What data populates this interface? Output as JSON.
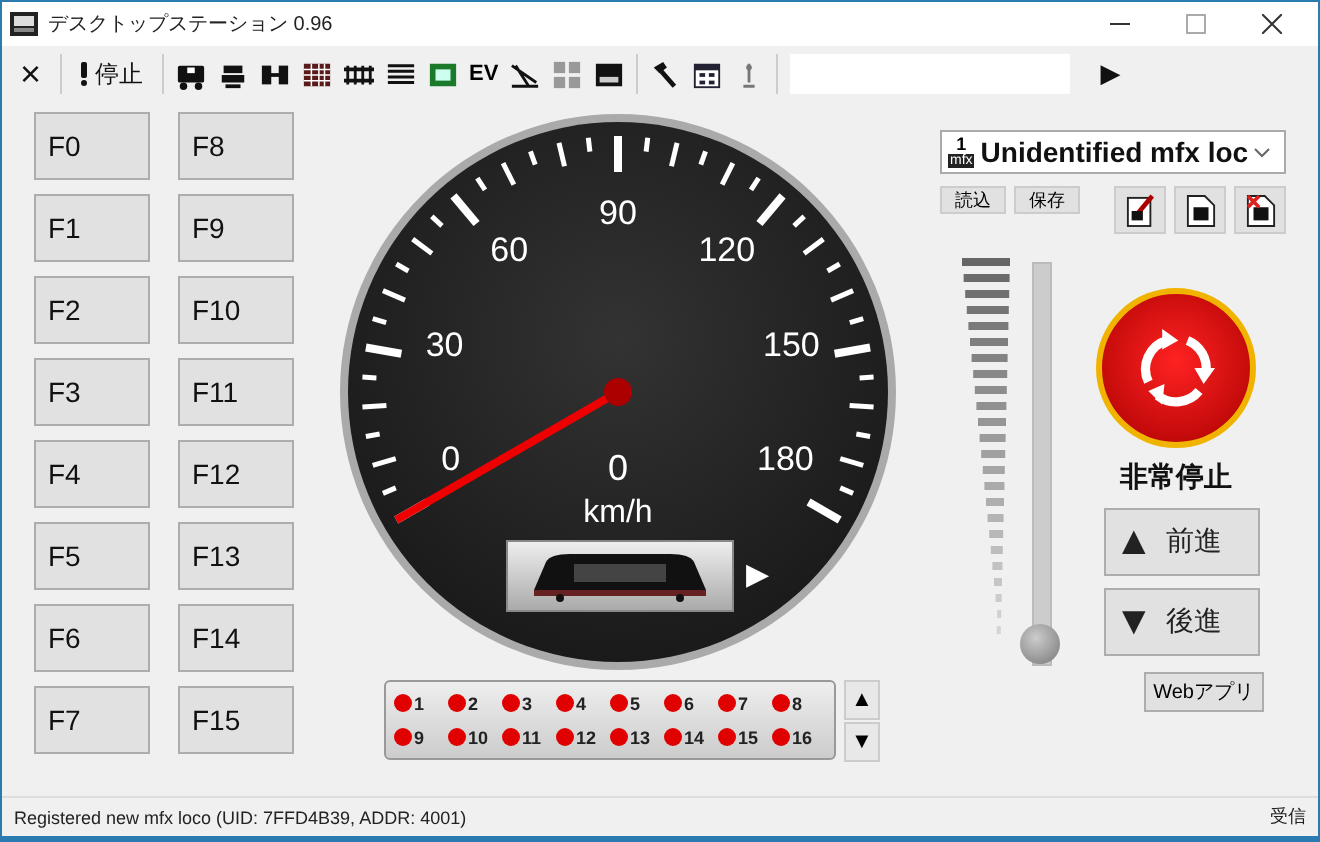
{
  "window": {
    "title": "デスクトップステーション 0.96"
  },
  "toolbar": {
    "close_glyph": "×",
    "stop_label": "停止",
    "ev_label": "EV",
    "run_glyph": "▶"
  },
  "function_buttons": [
    "F0",
    "F8",
    "F1",
    "F9",
    "F2",
    "F10",
    "F3",
    "F11",
    "F4",
    "F12",
    "F5",
    "F13",
    "F6",
    "F14",
    "F7",
    "F15"
  ],
  "speedometer": {
    "scale_labels": [
      "0",
      "30",
      "60",
      "90",
      "120",
      "150",
      "180"
    ],
    "reading": "0",
    "unit": "km/h",
    "direction_glyph": "▶"
  },
  "function_leds": [
    {
      "label": "1",
      "active": false
    },
    {
      "label": "2",
      "active": false
    },
    {
      "label": "3",
      "active": false
    },
    {
      "label": "4",
      "active": false
    },
    {
      "label": "5",
      "active": false
    },
    {
      "label": "6",
      "active": false
    },
    {
      "label": "7",
      "active": false
    },
    {
      "label": "8",
      "active": false
    },
    {
      "label": "9",
      "active": false
    },
    {
      "label": "10",
      "active": false
    },
    {
      "label": "11",
      "active": false
    },
    {
      "label": "12",
      "active": false
    },
    {
      "label": "13",
      "active": false
    },
    {
      "label": "14",
      "active": false
    },
    {
      "label": "15",
      "active": false
    },
    {
      "label": "16",
      "active": false
    }
  ],
  "led_pager": {
    "up": "▲",
    "down": "▼"
  },
  "loco_select": {
    "address": "1",
    "protocol": "mfx",
    "value": "Unidentified mfx loc"
  },
  "load_button": "読込",
  "save_button": "保存",
  "throttle": {
    "level": 0
  },
  "emergency_stop": {
    "label": "非常停止"
  },
  "forward_button": {
    "glyph": "▲",
    "label": "前進"
  },
  "reverse_button": {
    "glyph": "▼",
    "label": "後進"
  },
  "web_app_button": "Webアプリ",
  "status_bar": {
    "message": "Registered new mfx loco (UID: 7FFD4B39, ADDR: 4001)",
    "state": "受信"
  }
}
